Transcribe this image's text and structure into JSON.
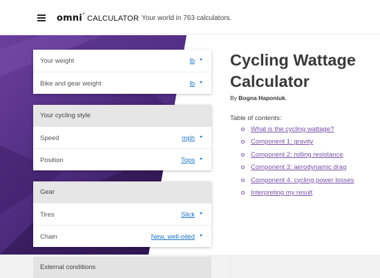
{
  "header": {
    "brand_omni": "omni",
    "brand_calculator": "CALCULATOR",
    "tagline": "Your world in 763 calculators."
  },
  "colors": {
    "hero_purple": "#4b2a7b",
    "link_blue": "#1a75c9",
    "toc_purple": "#7a4fa6"
  },
  "panels": {
    "weights": {
      "rows": [
        {
          "label": "Your weight",
          "unit": "lb"
        },
        {
          "label": "Bike and gear weight",
          "unit": "lb"
        }
      ]
    },
    "cycling_style": {
      "title": "Your cycling style",
      "rows": [
        {
          "label": "Speed",
          "unit": "mph"
        },
        {
          "label": "Position",
          "unit": "Tops"
        }
      ]
    },
    "gear": {
      "title": "Gear",
      "rows": [
        {
          "label": "Tires",
          "unit": "Slick"
        },
        {
          "label": "Chain",
          "unit": "New, well-oiled"
        }
      ]
    },
    "external": {
      "title": "External conditions"
    }
  },
  "article": {
    "title_line1": "Cycling Wattage",
    "title_line2": "Calculator",
    "byline_prefix": "By",
    "author": "Bogna Haponiuk",
    "byline_suffix": ".",
    "toc_heading": "Table of contents:",
    "toc": [
      "What is the cycling wattage?",
      "Component 1: gravity",
      "Component 2: rolling resistance",
      "Component 3: aerodynamic drag",
      "Component 4: cycling power losses",
      "Interpreting my result"
    ]
  }
}
